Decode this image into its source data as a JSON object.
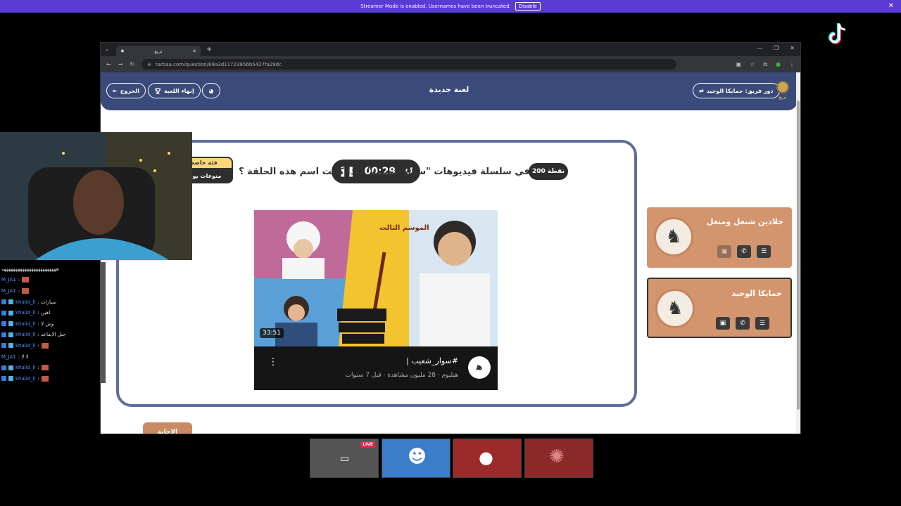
{
  "banner": {
    "text": "Streamer Mode is enabled. Usernames have been truncated.",
    "disable_label": "Disable",
    "close": "✕"
  },
  "browser": {
    "tab_title": "تربع",
    "url": "tarbaa.com/question/69a3d1172395bb5427fa29dc"
  },
  "header": {
    "title": "لعبة جديدة",
    "turn_button": "دور فريق: جمايكا الوحيد",
    "end_game": "إنهاء اللعبة",
    "exit": "الخروج",
    "logo_text": "تربع"
  },
  "question": {
    "category_label": "فئة خاصة",
    "category_name": "منوعات يوت",
    "timer": "00:29",
    "points": "200 نقطة",
    "text": "في سلسلة فيديوهات \"سوار شعيب\" ماذا كانت اسم هذه الحلقة ؟",
    "answer_button": "الإجابة"
  },
  "video": {
    "duration": "33:51",
    "season": "الموسم الثالث",
    "title": "#سوار_شعيب |",
    "channel": "هيليوم · 28 مليون مشاهدة · قبل 7 سنوات",
    "logo": "ﻫ"
  },
  "teams": [
    {
      "name": "جلادين شنغل ومنغل",
      "active": false
    },
    {
      "name": "جمايكا الوحيد",
      "active": true
    }
  ],
  "chat": [
    {
      "user": "",
      "msg": "ههههههههههههههههههههههههه",
      "emote": false,
      "badges": false
    },
    {
      "user": "M_JA1",
      "msg": ":",
      "emote": true,
      "badges": false
    },
    {
      "user": "M_JA1",
      "msg": ":",
      "emote": true,
      "badges": false
    },
    {
      "user": "khalid_ll",
      "msg": ": سيارات",
      "emote": false,
      "badges": true
    },
    {
      "user": "khalid_ll",
      "msg": ": اهين",
      "emote": false,
      "badges": true
    },
    {
      "user": "khalid_ll",
      "msg": ": وش لا",
      "emote": false,
      "badges": true
    },
    {
      "user": "khalid_ll",
      "msg": ": جبل الايفاعد",
      "emote": false,
      "badges": true
    },
    {
      "user": "khalid_ll",
      "msg": ":",
      "emote": true,
      "badges": true
    },
    {
      "user": "M_JA1",
      "msg": ": لا لا",
      "emote": false,
      "badges": false
    },
    {
      "user": "khalid_ll",
      "msg": ":",
      "emote": true,
      "badges": true
    },
    {
      "user": "khalid_ll",
      "msg": ":",
      "emote": true,
      "badges": true
    }
  ],
  "participants": {
    "live_label": "LIVE"
  },
  "colors": {
    "banner": "#5b3bd6",
    "header": "#3a4a7a",
    "team_card": "#d3956d",
    "board_border": "#5f6e9a"
  }
}
